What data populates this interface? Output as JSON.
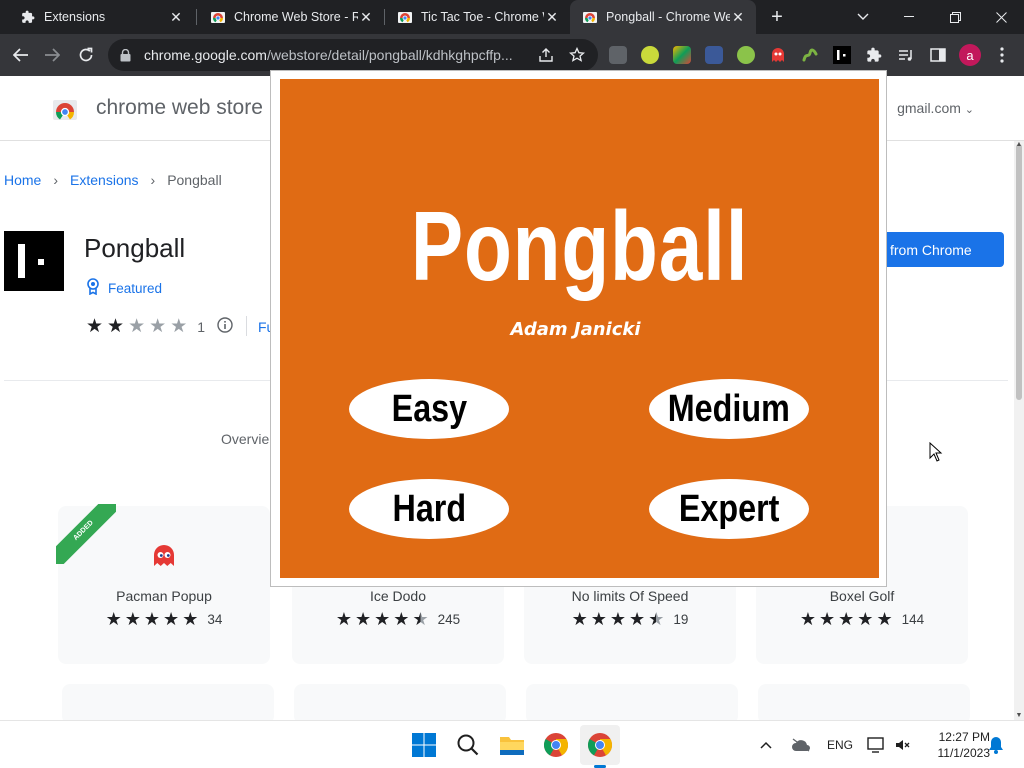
{
  "tabs": [
    {
      "title": "Extensions",
      "active": false,
      "favicon": "puzzle-icon"
    },
    {
      "title": "Chrome Web Store - R",
      "active": false,
      "favicon": "webstore-icon"
    },
    {
      "title": "Tic Tac Toe - Chrome W",
      "active": false,
      "favicon": "webstore-icon"
    },
    {
      "title": "Pongball - Chrome We",
      "active": true,
      "favicon": "webstore-icon"
    }
  ],
  "toolbar": {
    "url_host": "chrome.google.com",
    "url_path": "/webstore/detail/pongball/kdhkghpcffp...",
    "profile_initial": "a"
  },
  "store": {
    "header_title": "chrome web store",
    "account": "gmail.com",
    "breadcrumb": [
      "Home",
      "Pongball",
      "Extensions"
    ],
    "extension_name": "Pongball",
    "featured_label": "Featured",
    "rating_count": "1",
    "rating_value": 2,
    "fu_link": "Fu",
    "add_button": "from Chrome",
    "overview_tab": "Overvie",
    "added_badge": "ADDED"
  },
  "related": [
    {
      "name": "Pacman Popup",
      "count": "34",
      "stars": 5
    },
    {
      "name": "Ice Dodo",
      "count": "245",
      "stars": 4.5
    },
    {
      "name": "No limits Of Speed",
      "count": "19",
      "stars": 4.5
    },
    {
      "name": "Boxel Golf",
      "count": "144",
      "stars": 5
    }
  ],
  "game": {
    "title": "Pongball",
    "author": "Adam Janicki",
    "levels": [
      "Easy",
      "Medium",
      "Hard",
      "Expert"
    ],
    "bg_color": "#e06b14"
  },
  "taskbar": {
    "language": "ENG",
    "time": "12:27 PM",
    "date": "11/1/2023"
  },
  "colors": {
    "accent": "#1a73e8",
    "chrome_dark": "#202124",
    "toolbar": "#35363a"
  }
}
